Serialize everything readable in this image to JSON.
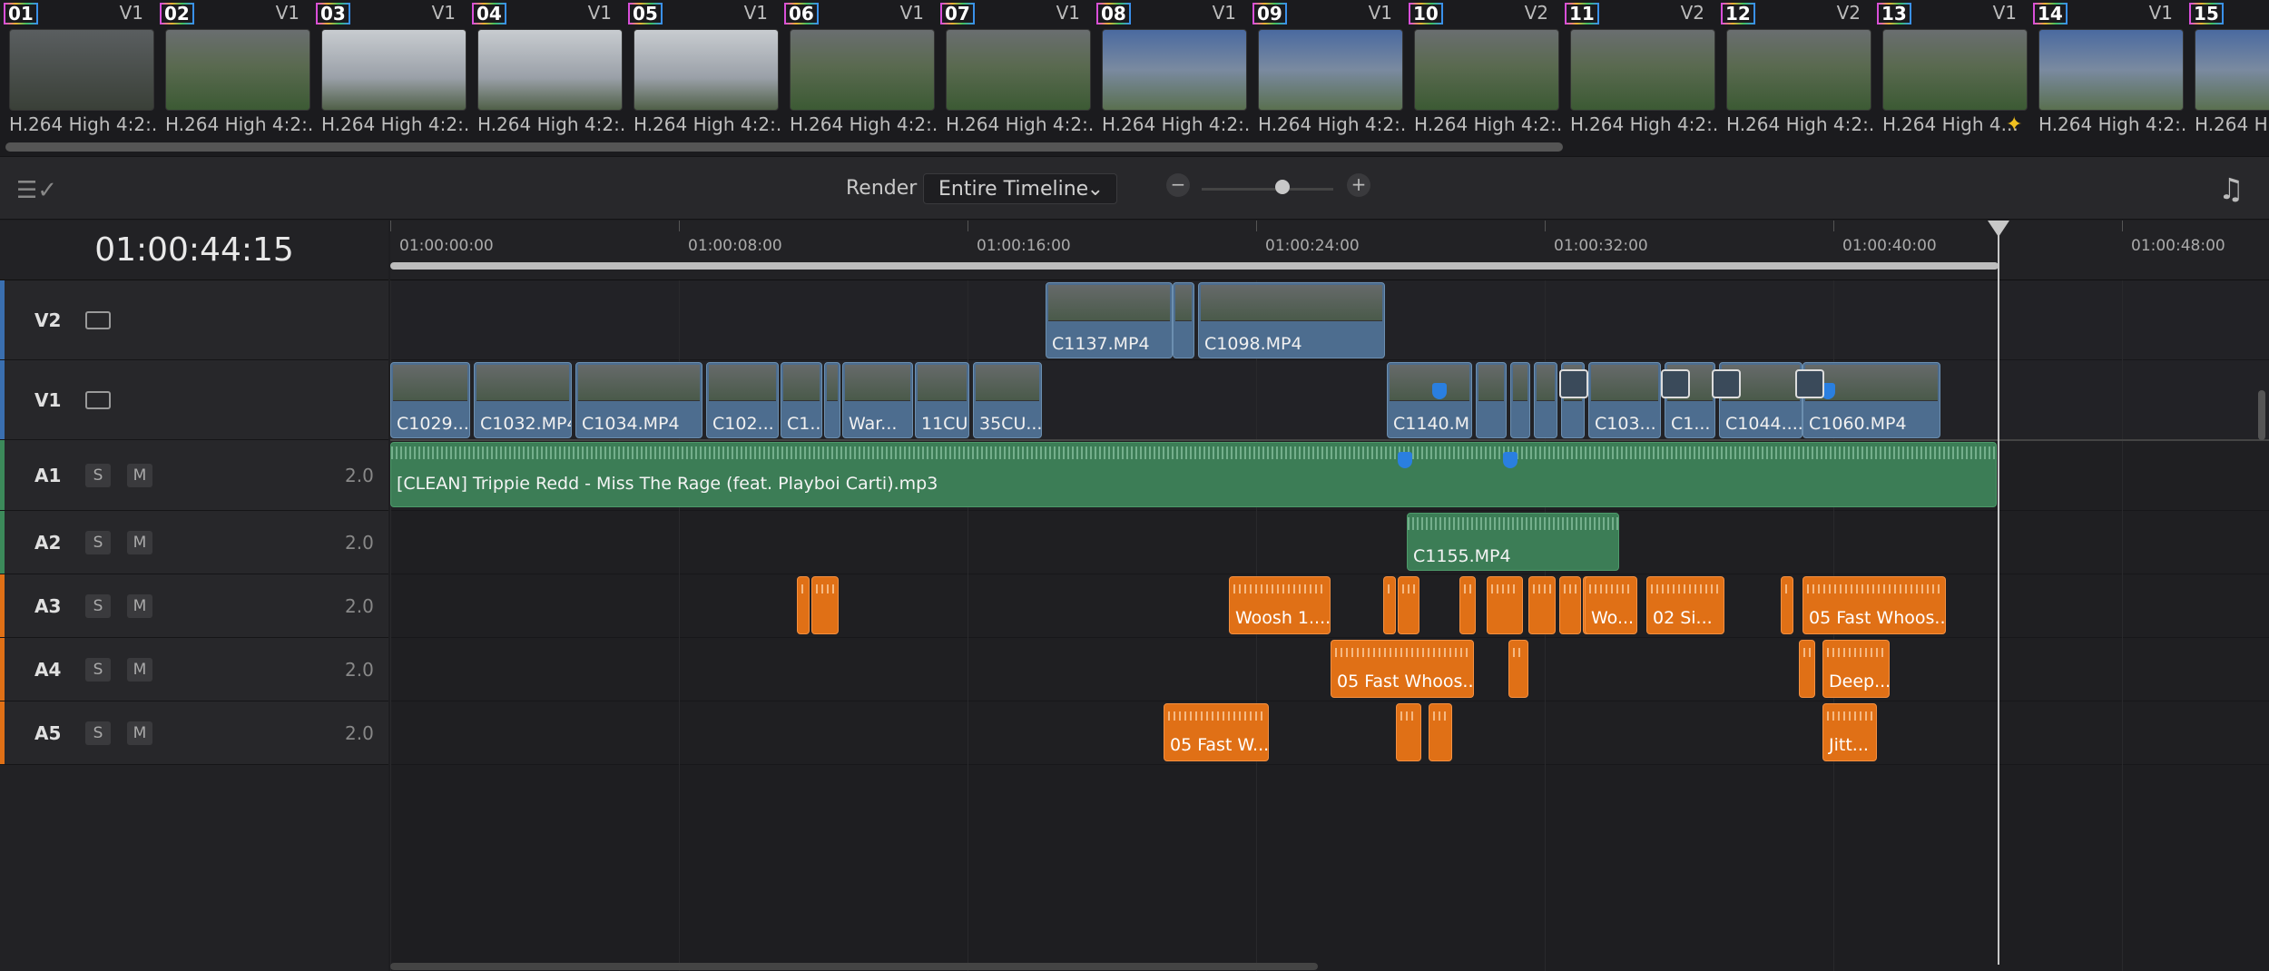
{
  "thumbnails": [
    {
      "num": "01",
      "track": "V1",
      "label": "H.264 High 4:2:...",
      "scene": "dark"
    },
    {
      "num": "02",
      "track": "V1",
      "label": "H.264 High 4:2:...",
      "scene": "field"
    },
    {
      "num": "03",
      "track": "V1",
      "label": "H.264 High 4:2:...",
      "scene": "sky"
    },
    {
      "num": "04",
      "track": "V1",
      "label": "H.264 High 4:2:...",
      "scene": "sky"
    },
    {
      "num": "05",
      "track": "V1",
      "label": "H.264 High 4:2:...",
      "scene": "sky"
    },
    {
      "num": "06",
      "track": "V1",
      "label": "H.264 High 4:2:...",
      "scene": "field"
    },
    {
      "num": "07",
      "track": "V1",
      "label": "H.264 High 4:2:...",
      "scene": "field"
    },
    {
      "num": "08",
      "track": "V1",
      "label": "H.264 High 4:2:...",
      "scene": "stands"
    },
    {
      "num": "09",
      "track": "V1",
      "label": "H.264 High 4:2:...",
      "scene": "stands"
    },
    {
      "num": "10",
      "track": "V2",
      "label": "H.264 High 4:2:...",
      "scene": "field"
    },
    {
      "num": "11",
      "track": "V2",
      "label": "H.264 High 4:2:...",
      "scene": "field"
    },
    {
      "num": "12",
      "track": "V2",
      "label": "H.264 High 4:2:...",
      "scene": "field"
    },
    {
      "num": "13",
      "track": "V1",
      "label": "H.264 High 4...",
      "scene": "field"
    },
    {
      "num": "14",
      "track": "V1",
      "label": "H.264 High 4:2:...",
      "scene": "stands"
    },
    {
      "num": "15",
      "track": "",
      "label": "H.264 Hig",
      "scene": "stands"
    }
  ],
  "toolbar": {
    "render_label": "Render",
    "render_value": "Entire Timeline",
    "zoom_out": "−",
    "zoom_in": "+",
    "music_icon": "music-note-icon"
  },
  "timecode": "01:00:44:15",
  "ruler": [
    "01:00:00:00",
    "01:00:08:00",
    "01:00:16:00",
    "01:00:24:00",
    "01:00:32:00",
    "01:00:40:00",
    "01:00:48:00"
  ],
  "tracks": [
    {
      "name": "V2",
      "type": "video",
      "color": "#3a6fb0"
    },
    {
      "name": "V1",
      "type": "video",
      "color": "#3a6fb0"
    },
    {
      "name": "A1",
      "type": "audio",
      "color": "#3c8a5a",
      "s": "S",
      "m": "M",
      "ch": "2.0"
    },
    {
      "name": "A2",
      "type": "audio",
      "color": "#3c8a5a",
      "s": "S",
      "m": "M",
      "ch": "2.0"
    },
    {
      "name": "A3",
      "type": "audio",
      "color": "#e07016",
      "s": "S",
      "m": "M",
      "ch": "2.0"
    },
    {
      "name": "A4",
      "type": "audio",
      "color": "#e07016",
      "s": "S",
      "m": "M",
      "ch": "2.0"
    },
    {
      "name": "A5",
      "type": "audio",
      "color": "#e07016",
      "s": "S",
      "m": "M",
      "ch": "2.0"
    }
  ],
  "clips": {
    "v2": [
      "C1137.MP4",
      "",
      "C1098.MP4"
    ],
    "v1": [
      "C1029....",
      "C1032.MP4",
      "C1034.MP4",
      "C102...",
      "C1...",
      "",
      "War...",
      "11CU",
      "35CU...",
      "C1140.M...",
      "",
      "",
      "",
      "",
      "C103...",
      "C1...",
      "C1044....",
      "C1060.MP4"
    ],
    "a1": "[CLEAN] Trippie Redd - Miss The Rage (feat. Playboi Carti).mp3",
    "a2": "C1155.MP4",
    "a3": [
      "",
      "",
      "Woosh 1....",
      "",
      "",
      "",
      "",
      "",
      "",
      "",
      "Wo...",
      "02 Si...",
      "",
      "05 Fast Whoos..."
    ],
    "a4": [
      "05 Fast Whoos...",
      "",
      "",
      "Deep..."
    ],
    "a5": [
      "05 Fast W...",
      "",
      "",
      "Jitt..."
    ]
  }
}
